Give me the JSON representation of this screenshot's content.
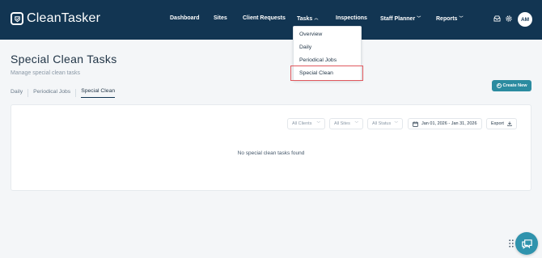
{
  "brand": {
    "name": "CleanTasker"
  },
  "nav": {
    "items": [
      {
        "label": "Dashboard"
      },
      {
        "label": "Sites"
      },
      {
        "label": "Client Requests"
      },
      {
        "label": "Tasks"
      },
      {
        "label": "Inspections"
      },
      {
        "label": "Staff Planner"
      },
      {
        "label": "Reports"
      }
    ],
    "tasks_menu": [
      "Overview",
      "Daily",
      "Periodical Jobs",
      "Special Clean"
    ],
    "highlighted_menu_item": "Special Clean"
  },
  "user": {
    "initials": "AM"
  },
  "page": {
    "title": "Special Clean Tasks",
    "subtitle": "Manage special clean tasks"
  },
  "tabs": [
    {
      "label": "Daily"
    },
    {
      "label": "Periodical Jobs"
    },
    {
      "label": "Special Clean"
    }
  ],
  "active_tab": "Special Clean",
  "actions": {
    "create_label": "Create New"
  },
  "filters": {
    "clients": "All Clients",
    "sites": "All Sites",
    "status": "All Status",
    "date_range": "Jan 01, 2026 - Jan 31, 2026",
    "export_label": "Export"
  },
  "empty_state": "No special clean tasks found",
  "colors": {
    "header_bg": "#123552",
    "accent": "#2b8ba0",
    "chat_button": "#2f93ad",
    "highlight_border": "#e0585e"
  },
  "icons": [
    "clean-tasker-logo-icon",
    "inbox-icon",
    "gear-icon",
    "chevron-down-icon",
    "chevron-up-icon",
    "plus-circle-icon",
    "calendar-icon",
    "download-icon",
    "drag-handle-icon",
    "chat-icon"
  ]
}
